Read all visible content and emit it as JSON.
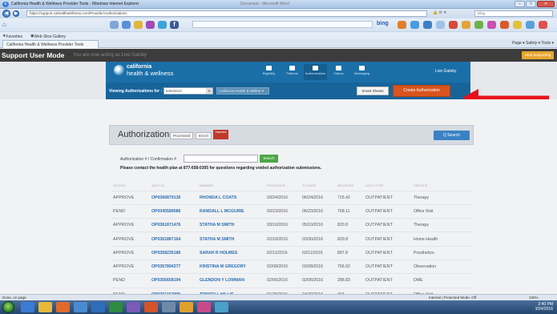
{
  "browser": {
    "window_title": "California Health & Wellness Provider Tools - Windows Internet Explorer",
    "window_title_faded": "Document - Microsoft Word",
    "address_url": "https://support.cahealthwellness.com/Provider/Authorizations",
    "search_placeholder": "Bing",
    "favorites_label": "Favorites",
    "web_slice_label": "Web Slice Gallery",
    "tab_label": "California Health & Wellness Provider Tools",
    "command_bar": "Page ▾  Safety ▾  Tools ▾",
    "bing_label": "bing",
    "status_left": "Done, on page.",
    "status_right": "Internet | Protected Mode: Off",
    "zoom": "100%"
  },
  "support_bar": {
    "mode_label": "Support User Mode",
    "viewing_as": "You are now acting as Live Gatsby",
    "stop_button": "Stop Supporting"
  },
  "portal": {
    "logo_line1": "california",
    "logo_line2": "health & wellness",
    "nav": [
      {
        "label": "Eligibility"
      },
      {
        "label": "Patients"
      },
      {
        "label": "Authorizations"
      },
      {
        "label": "Claims"
      },
      {
        "label": "Messaging"
      }
    ],
    "user_label": "Live Gatsby",
    "viewing_label": "Viewing Authorizations for :",
    "provider_id": "84833022",
    "provider_select_2": "California Health & Wellne ▾",
    "smart_sheets": "Smart Sheets",
    "create_auth": "Create Authorization"
  },
  "auth_panel": {
    "title": "Authorizations",
    "tab_processed": "Processed",
    "tab_errors": "Errors",
    "imported_badge": "Imported",
    "quick_search": "Q Search",
    "search_label": "Authorization # / Confirmation #",
    "search_button": "Search",
    "note": "Please contact the health plan at 877-658-0305 for questions regarding voided authorization submissions."
  },
  "table": {
    "headers": [
      "STATUS",
      "AUTH ID",
      "MEMBER",
      "FROM DATE",
      "TO DATE",
      "RECEIVED",
      "AUTH TYPE",
      "SERVICE"
    ],
    "rows": [
      [
        "APPROVE",
        "OP0366879136",
        "RHONDA L COATS",
        "03/24/2016",
        "06/24/2016",
        "715.42",
        "OUTPATIENT",
        "Therapy"
      ],
      [
        "PEND",
        "OP0345589086",
        "RANDALL L MCGUIRE",
        "03/23/2016",
        "06/23/2016",
        "758.11",
        "OUTPATIENT",
        "Office Visit"
      ],
      [
        "APPROVE",
        "OP0361871476",
        "STATHA M SMITH",
        "03/10/2016",
        "05/10/2016",
        "820.8",
        "OUTPATIENT",
        "Therapy"
      ],
      [
        "APPROVE",
        "OP0361887164",
        "STATHA M SMITH",
        "02/18/2016",
        "03/30/2016",
        "820.8",
        "OUTPATIENT",
        "Home Health"
      ],
      [
        "APPROVE",
        "OP0358235186",
        "SARAH R HOLMES",
        "02/11/2016",
        "03/11/2016",
        "897.8",
        "OUTPATIENT",
        "Prosthetics"
      ],
      [
        "APPROVE",
        "OP0357894277",
        "KRISTINA M GREGORY",
        "02/08/2016",
        "02/08/2016",
        "756.92",
        "OUTPATIENT",
        "Observation"
      ],
      [
        "PEND",
        "OP0356658194",
        "GLENDON Y LOWMAN",
        "02/06/2016",
        "02/06/2016",
        "288.83",
        "OUTPATIENT",
        "DME"
      ],
      [
        "PEND",
        "OP0361157999",
        "TRINITY L HILLIS",
        "01/29/2016",
        "04/29/2016",
        "463",
        "OUTPATIENT",
        "Office Visit"
      ]
    ]
  },
  "taskbar": {
    "time": "2:40 PM",
    "date": "3/24/2016"
  },
  "colors": {
    "portal_blue": "#1b6fa8",
    "create_orange": "#d9541e",
    "arrow_red": "#e8101c",
    "link_blue": "#2a6eb0"
  }
}
